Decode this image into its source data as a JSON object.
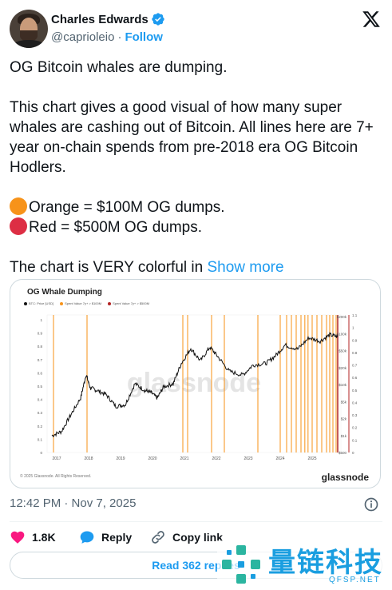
{
  "author": {
    "name": "Charles Edwards",
    "handle": "@caprioleio",
    "separator": "·",
    "follow_label": "Follow"
  },
  "text": {
    "line1": "OG Bitcoin whales are dumping.",
    "para2": "This chart gives a good visual of how many super whales are cashing out of Bitcoin. All lines here are 7+ year on-chain spends from pre-2018 era OG Bitcoin Hodlers.",
    "orange_line": "Orange = $100M OG dumps.",
    "red_line": "Red = $500M OG dumps.",
    "para4": "The chart is VERY colorful in",
    "show_more": "Show more"
  },
  "colors": {
    "accent": "#1d9bf0",
    "orange": "#f7931a",
    "red": "#dd2e44"
  },
  "chart_data": {
    "type": "line",
    "title": "OG Whale Dumping",
    "legend": [
      "BTC: Price [USD]",
      "Spent Value 7y+ > $100M",
      "Spent Value 7y+ > $500M"
    ],
    "x_ticks": [
      "2017",
      "2018",
      "2019",
      "2020",
      "2021",
      "2022",
      "2023",
      "2024",
      "2025"
    ],
    "left_ticks": [
      "1",
      "0.9",
      "0.8",
      "0.7",
      "0.6",
      "0.5",
      "0.4",
      "0.3",
      "0.2",
      "0.1",
      "0"
    ],
    "right_price_ticks": [
      "$200k",
      "$100k",
      "$50k",
      "$20k",
      "$10k",
      "$5k",
      "$2k",
      "$1k",
      "$500"
    ],
    "right_ticks": [
      "1.1",
      "1",
      "0.9",
      "0.8",
      "0.7",
      "0.6",
      "0.5",
      "0.4",
      "0.3",
      "0.2",
      "0.1",
      "0"
    ],
    "watermark": "glassnode",
    "copyright": "© 2025 Glassnode. All Rights Reserved.",
    "brand": "glassnode",
    "price_series": [
      [
        2016.9,
        900
      ],
      [
        2017.2,
        1100
      ],
      [
        2017.5,
        2500
      ],
      [
        2017.8,
        5500
      ],
      [
        2017.97,
        17000
      ],
      [
        2018.1,
        9000
      ],
      [
        2018.3,
        8000
      ],
      [
        2018.6,
        6500
      ],
      [
        2018.9,
        3700
      ],
      [
        2019.2,
        4000
      ],
      [
        2019.5,
        11000
      ],
      [
        2019.8,
        8000
      ],
      [
        2020.0,
        7200
      ],
      [
        2020.2,
        5500
      ],
      [
        2020.4,
        9500
      ],
      [
        2020.7,
        11000
      ],
      [
        2020.95,
        29000
      ],
      [
        2021.25,
        60000
      ],
      [
        2021.55,
        33000
      ],
      [
        2021.85,
        64000
      ],
      [
        2022.1,
        40000
      ],
      [
        2022.45,
        20000
      ],
      [
        2022.87,
        16500
      ],
      [
        2023.2,
        27000
      ],
      [
        2023.6,
        29000
      ],
      [
        2023.9,
        42000
      ],
      [
        2024.2,
        70000
      ],
      [
        2024.6,
        58000
      ],
      [
        2024.95,
        100000
      ],
      [
        2025.3,
        85000
      ],
      [
        2025.6,
        115000
      ],
      [
        2025.85,
        105000
      ]
    ],
    "dumps_100m": [
      2016.95,
      2018.0,
      2021.0,
      2021.15,
      2021.9,
      2022.3,
      2023.35,
      2024.05,
      2024.25,
      2024.4,
      2024.55,
      2024.7,
      2024.82,
      2024.92,
      2025.05,
      2025.2,
      2025.35,
      2025.5,
      2025.6,
      2025.7,
      2025.8
    ],
    "dumps_500m": [
      2025.85
    ]
  },
  "timestamp": "12:42 PM · Nov 7, 2025",
  "actions": {
    "likes": "1.8K",
    "reply_label": "Reply",
    "copy_label": "Copy link"
  },
  "read_replies": "Read 362 replies",
  "watermark": {
    "text": "量链科技",
    "url": "QFSP.NET"
  }
}
